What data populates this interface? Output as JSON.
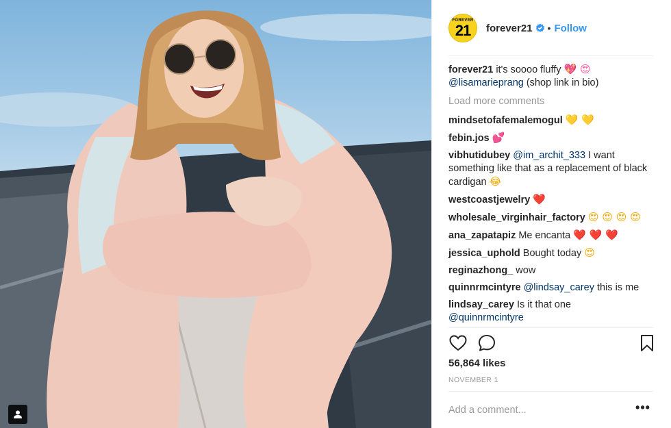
{
  "account": {
    "username": "forever21",
    "avatar_small_text": "FOREVER",
    "avatar_big_text": "21",
    "follow_label": "Follow",
    "separator": "•"
  },
  "caption": {
    "username": "forever21",
    "text": " it's soooo fluffy ",
    "emojis": "💖 😍",
    "mention": "@lisamarieprang",
    "text2": " (shop link in bio)"
  },
  "load_more": "Load more comments",
  "comments": [
    {
      "user": "mindsetofafemalemogul",
      "text": " ",
      "emoji": "💛 💛"
    },
    {
      "user": "febin.jos",
      "text": " ",
      "emoji": "💕"
    },
    {
      "user": "vibhutidubey",
      "mention": "@im_archit_333",
      "text": " I want something like that as a replacement of black cardigan ",
      "emoji": "😂"
    },
    {
      "user": "westcoastjewelry",
      "text": " ",
      "emoji": "❤️"
    },
    {
      "user": "wholesale_virginhair_factory",
      "text": " ",
      "emoji": "😍 😍 😍 😍"
    },
    {
      "user": "ana_zapatapiz",
      "text": " Me encanta ",
      "emoji": "❤️ ❤️ ❤️"
    },
    {
      "user": "jessica_uphold",
      "text": " Bought today ",
      "emoji": "😍"
    },
    {
      "user": "reginazhong_",
      "text": " wow",
      "emoji": ""
    },
    {
      "user": "quinnrmcintyre",
      "mention": "@lindsay_carey",
      "text": " this is me",
      "emoji": ""
    },
    {
      "user": "lindsay_carey",
      "text": " Is it that one ",
      "mention_after": "@quinnrmcintyre",
      "emoji": ""
    }
  ],
  "stats": {
    "likes": "56,864 likes",
    "date": "NOVEMBER 1"
  },
  "comment_input": {
    "placeholder": "Add a comment..."
  },
  "more_label": "•••",
  "icons": [
    "heart-icon",
    "comment-icon",
    "bookmark-icon",
    "verified-badge-icon",
    "user-tag-icon",
    "more-options-icon"
  ],
  "colors": {
    "link_blue": "#3897f0",
    "mention_blue": "#003569",
    "muted": "#999999",
    "brand_yellow": "#f7d21e"
  }
}
